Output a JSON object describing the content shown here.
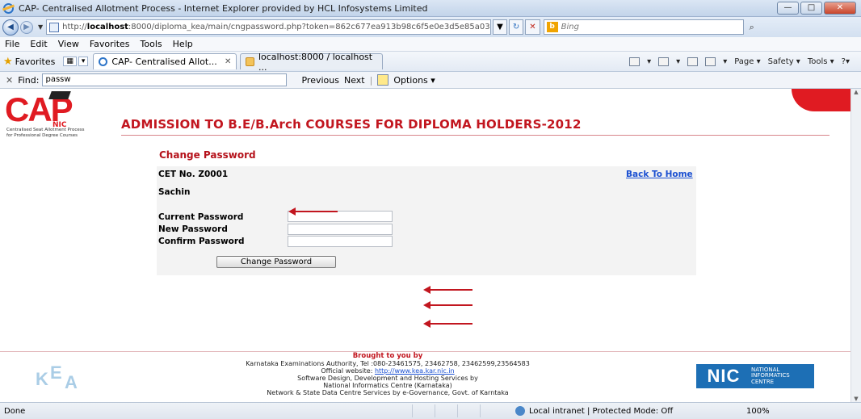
{
  "window": {
    "title": "CAP- Centralised Allotment Process - Internet Explorer provided by HCL Infosystems Limited",
    "min": "—",
    "max": "□",
    "close": "✕"
  },
  "address": {
    "url_prefix": "http://",
    "url_host": "localhost",
    "url_rest": ":8000/diploma_kea/main/cngpassword.php?token=862c677ea913b98c6f5e0e3d5e85a03",
    "search_placeholder": "Bing"
  },
  "menu": [
    "File",
    "Edit",
    "View",
    "Favorites",
    "Tools",
    "Help"
  ],
  "favbar": {
    "favorites": "Favorites",
    "tabs": [
      {
        "label": "CAP- Centralised Allot..."
      },
      {
        "label": "localhost:8000 / localhost ..."
      }
    ],
    "commands": [
      "Page ▾",
      "Safety ▾",
      "Tools ▾"
    ]
  },
  "find": {
    "label": "Find:",
    "value": "passw",
    "prev": "Previous",
    "next": "Next",
    "options": "Options ▾"
  },
  "page": {
    "logo_main": "CAP",
    "logo_nic": "NIC",
    "logo_tag1": "Centralised Seat Allotment Process",
    "logo_tag2": "for Professional Degree Courses",
    "heading": "ADMISSION TO B.E/B.Arch COURSES FOR DIPLOMA HOLDERS-2012",
    "form_title": "Change Password",
    "cet": "CET No. Z0001",
    "back_home": "Back To Home",
    "name": "Sachin",
    "current_password_label": "Current Password",
    "new_password_label": "New Password",
    "confirm_password_label": "Confirm Password",
    "submit": "Change Password"
  },
  "footer": {
    "brought": "Brought to you by",
    "line1": "Karnataka Examinations Authority, Tel :080-23461575, 23462758, 23462599,23564583",
    "line2_prefix": "Official website: ",
    "line2_link": "http://www.kea.kar.nic.in",
    "line3": "Software Design, Development and Hosting Services by",
    "line4": "National Informatics Centre (Karnataka)",
    "line5": "Network & State Data Centre Services by e-Governance, Govt. of Karntaka",
    "kea_letters": [
      "K",
      "E",
      "A"
    ],
    "nic_logo": "NIC",
    "nic_text": [
      "NATIONAL",
      "INFORMATICS",
      "CENTRE"
    ]
  },
  "status": {
    "done": "Done",
    "zone": "Local intranet | Protected Mode: Off",
    "zoom": "100%"
  }
}
